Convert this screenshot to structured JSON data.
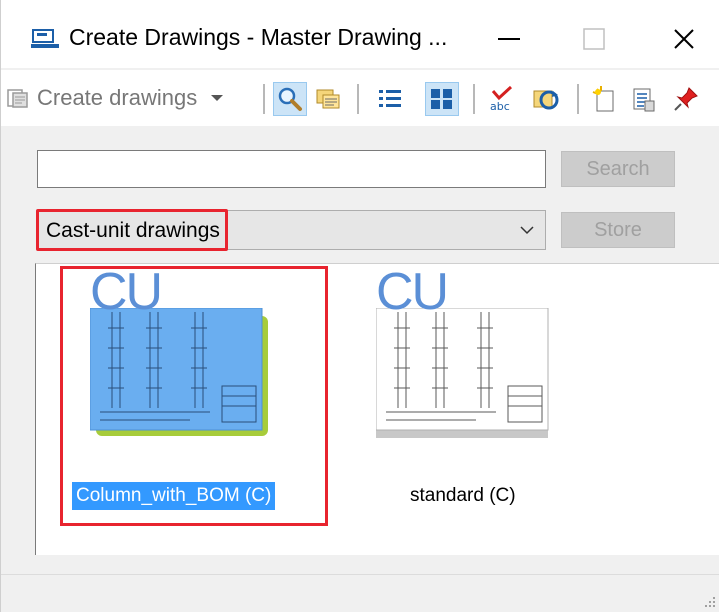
{
  "window": {
    "title": "Create Drawings - Master Drawing ...",
    "controls": {
      "minimize": "minimize-icon",
      "maximize": "maximize-icon",
      "close": "close-icon"
    }
  },
  "toolbar": {
    "create_label": "Create drawings",
    "buttons": [
      "search-icon",
      "folder-icon",
      "list-view-icon",
      "tile-view-icon",
      "spell-check-icon",
      "refresh-icon",
      "new-icon",
      "properties-icon",
      "pin-icon"
    ]
  },
  "search": {
    "value": "",
    "placeholder": "",
    "button_label": "Search"
  },
  "filter": {
    "selected": "Cast-unit drawings",
    "store_label": "Store"
  },
  "items": [
    {
      "badge": "CU",
      "label": "Column_with_BOM (C)",
      "selected": true
    },
    {
      "badge": "CU",
      "label": "standard (C)",
      "selected": false
    }
  ],
  "colors": {
    "accent": "#3399ff",
    "highlight": "#e8242f",
    "badge": "#5b8fd6"
  }
}
